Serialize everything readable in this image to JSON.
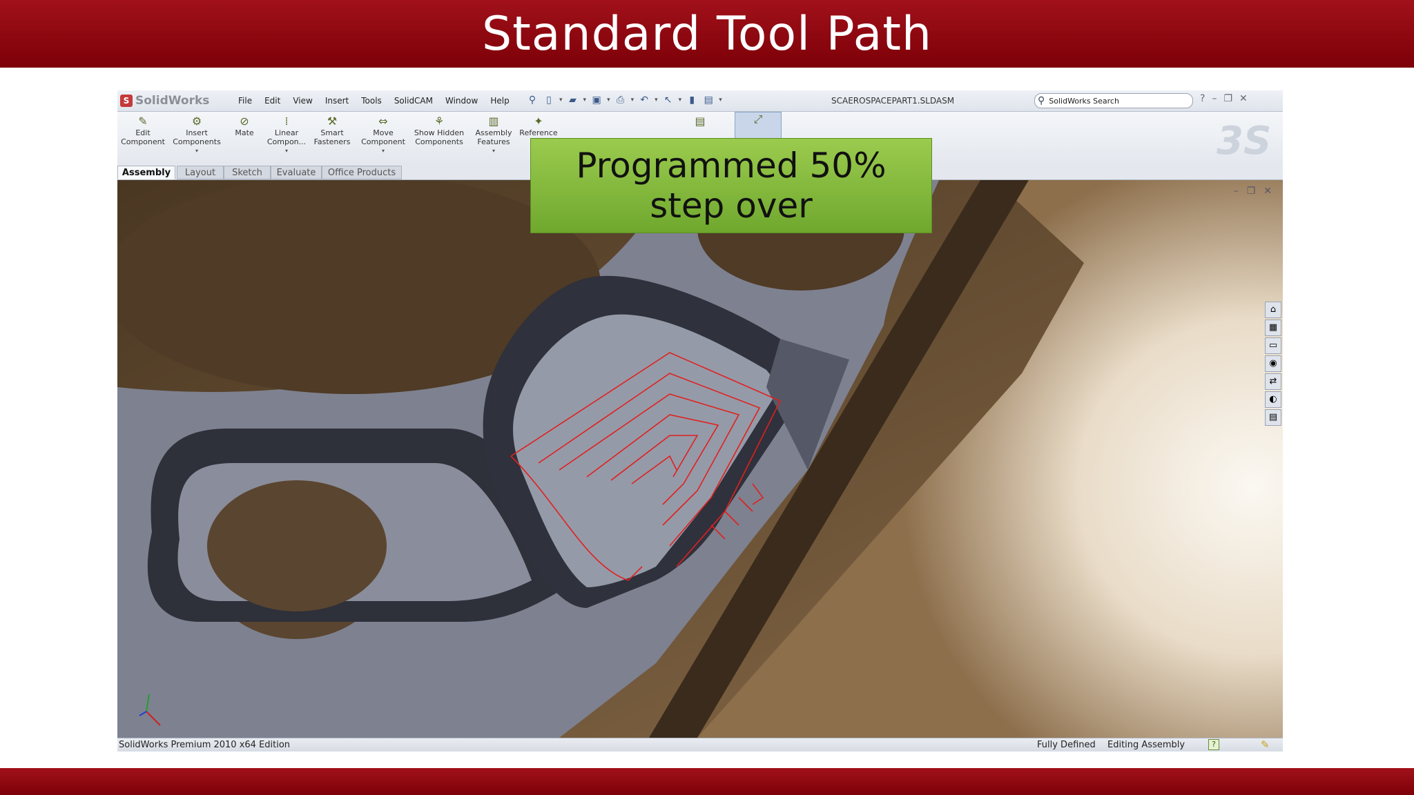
{
  "slide": {
    "title": "Standard Tool Path",
    "callout_line1": "Programmed 50%",
    "callout_line2": "step over"
  },
  "app": {
    "brand": "SolidWorks",
    "menu": [
      "File",
      "Edit",
      "View",
      "Insert",
      "Tools",
      "SolidCAM",
      "Window",
      "Help"
    ],
    "document_title": "SCAEROSPACEPART1.SLDASM",
    "search_placeholder": "SolidWorks Search",
    "commands": [
      {
        "label": "Edit Component",
        "icon": "edit-component-icon"
      },
      {
        "label": "Insert Components",
        "icon": "insert-components-icon"
      },
      {
        "label": "Mate",
        "icon": "mate-icon"
      },
      {
        "label": "Linear Compon...",
        "icon": "linear-pattern-icon"
      },
      {
        "label": "Smart Fasteners",
        "icon": "smart-fasteners-icon"
      },
      {
        "label": "Move Component",
        "icon": "move-component-icon"
      },
      {
        "label": "Show Hidden Components",
        "icon": "show-hidden-icon"
      },
      {
        "label": "Assembly Features",
        "icon": "assembly-features-icon"
      },
      {
        "label": "Reference Ge",
        "icon": "reference-geometry-icon"
      },
      {
        "label": "",
        "icon": "new-motion-icon"
      },
      {
        "label": "",
        "icon": "bill-of-materials-icon"
      },
      {
        "label": "",
        "icon": "exploded-view-icon"
      },
      {
        "label": "",
        "icon": "explode-line-icon"
      },
      {
        "label": "",
        "icon": "instant-3d-icon"
      }
    ],
    "tabs": [
      "Assembly",
      "Layout",
      "Sketch",
      "Evaluate",
      "Office Products"
    ],
    "active_tab": "Assembly",
    "status": {
      "edition": "SolidWorks Premium 2010 x64 Edition",
      "definition": "Fully Defined",
      "mode": "Editing Assembly",
      "help": "?"
    }
  },
  "colors": {
    "banner": "#8e0a12",
    "callout": "#8dbf45",
    "toolpath": "#e0201e",
    "part": "#8c8f9c",
    "background": "#5b4631"
  }
}
